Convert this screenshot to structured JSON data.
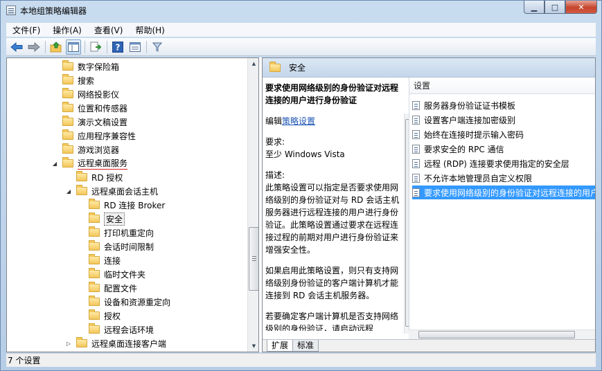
{
  "window": {
    "title": "本地组策略编辑器"
  },
  "menu": [
    "文件(F)",
    "操作(A)",
    "查看(V)",
    "帮助(H)"
  ],
  "toolbar_icons": [
    "back-arrow-icon",
    "forward-arrow-icon",
    "up-folder-icon",
    "console-tree-icon",
    "export-list-icon",
    "help-icon",
    "properties-icon",
    "filter-icon"
  ],
  "tree": {
    "items": [
      {
        "label": "数字保险箱"
      },
      {
        "label": "搜索"
      },
      {
        "label": "网络投影仪"
      },
      {
        "label": "位置和传感器"
      },
      {
        "label": "演示文稿设置"
      },
      {
        "label": "应用程序兼容性"
      },
      {
        "label": "游戏浏览器"
      },
      {
        "label": "远程桌面服务",
        "expanded": true
      },
      {
        "label": "RD 授权"
      },
      {
        "label": "远程桌面会话主机",
        "expanded": true
      },
      {
        "label": "RD 连接 Broker"
      },
      {
        "label": "安全",
        "selected": true
      },
      {
        "label": "打印机重定向"
      },
      {
        "label": "会话时间限制"
      },
      {
        "label": "连接"
      },
      {
        "label": "临时文件夹"
      },
      {
        "label": "配置文件"
      },
      {
        "label": "设备和资源重定向"
      },
      {
        "label": "授权"
      },
      {
        "label": "远程会话环境"
      },
      {
        "label": "远程桌面连接客户端",
        "collapsed": true
      }
    ]
  },
  "right": {
    "header": "安全",
    "desc_title": "要求使用网络级别的身份验证对远程连接的用户进行身份验证",
    "edit_prefix": "编辑",
    "edit_link": "策略设置",
    "req_label": "要求:",
    "req_value": "至少 Windows Vista",
    "desc_label": "描述:",
    "desc_body": "此策略设置可以指定是否要求使用网络级别的身份验证对与 RD 会话主机服务器进行远程连接的用户进行身份验证。此策略设置通过要求在远程连接过程的前期对用户进行身份验证来增强安全性。",
    "desc_more": "如果启用此策略设置，则只有支持网络级别身份验证的客户端计算机才能连接到 RD 会话主机服务器。",
    "desc_tail": "若要确定客户端计算机是否支持网络级别的身份验证，请启动远程",
    "settings_header": "设置",
    "settings": [
      "服务器身份验证证书模板",
      "设置客户端连接加密级别",
      "始终在连接时提示输入密码",
      "要求安全的 RPC 通信",
      "远程 (RDP) 连接要求使用指定的安全层",
      "不允许本地管理员自定义权限",
      "要求使用网络级别的身份验证对远程连接的用户"
    ],
    "selected_setting": 6,
    "tabs": [
      "扩展",
      "标准"
    ]
  },
  "status": "7 个设置",
  "colors": {
    "selection": "#3399ff",
    "link": "#1c54b4",
    "underline": "#d42020"
  }
}
